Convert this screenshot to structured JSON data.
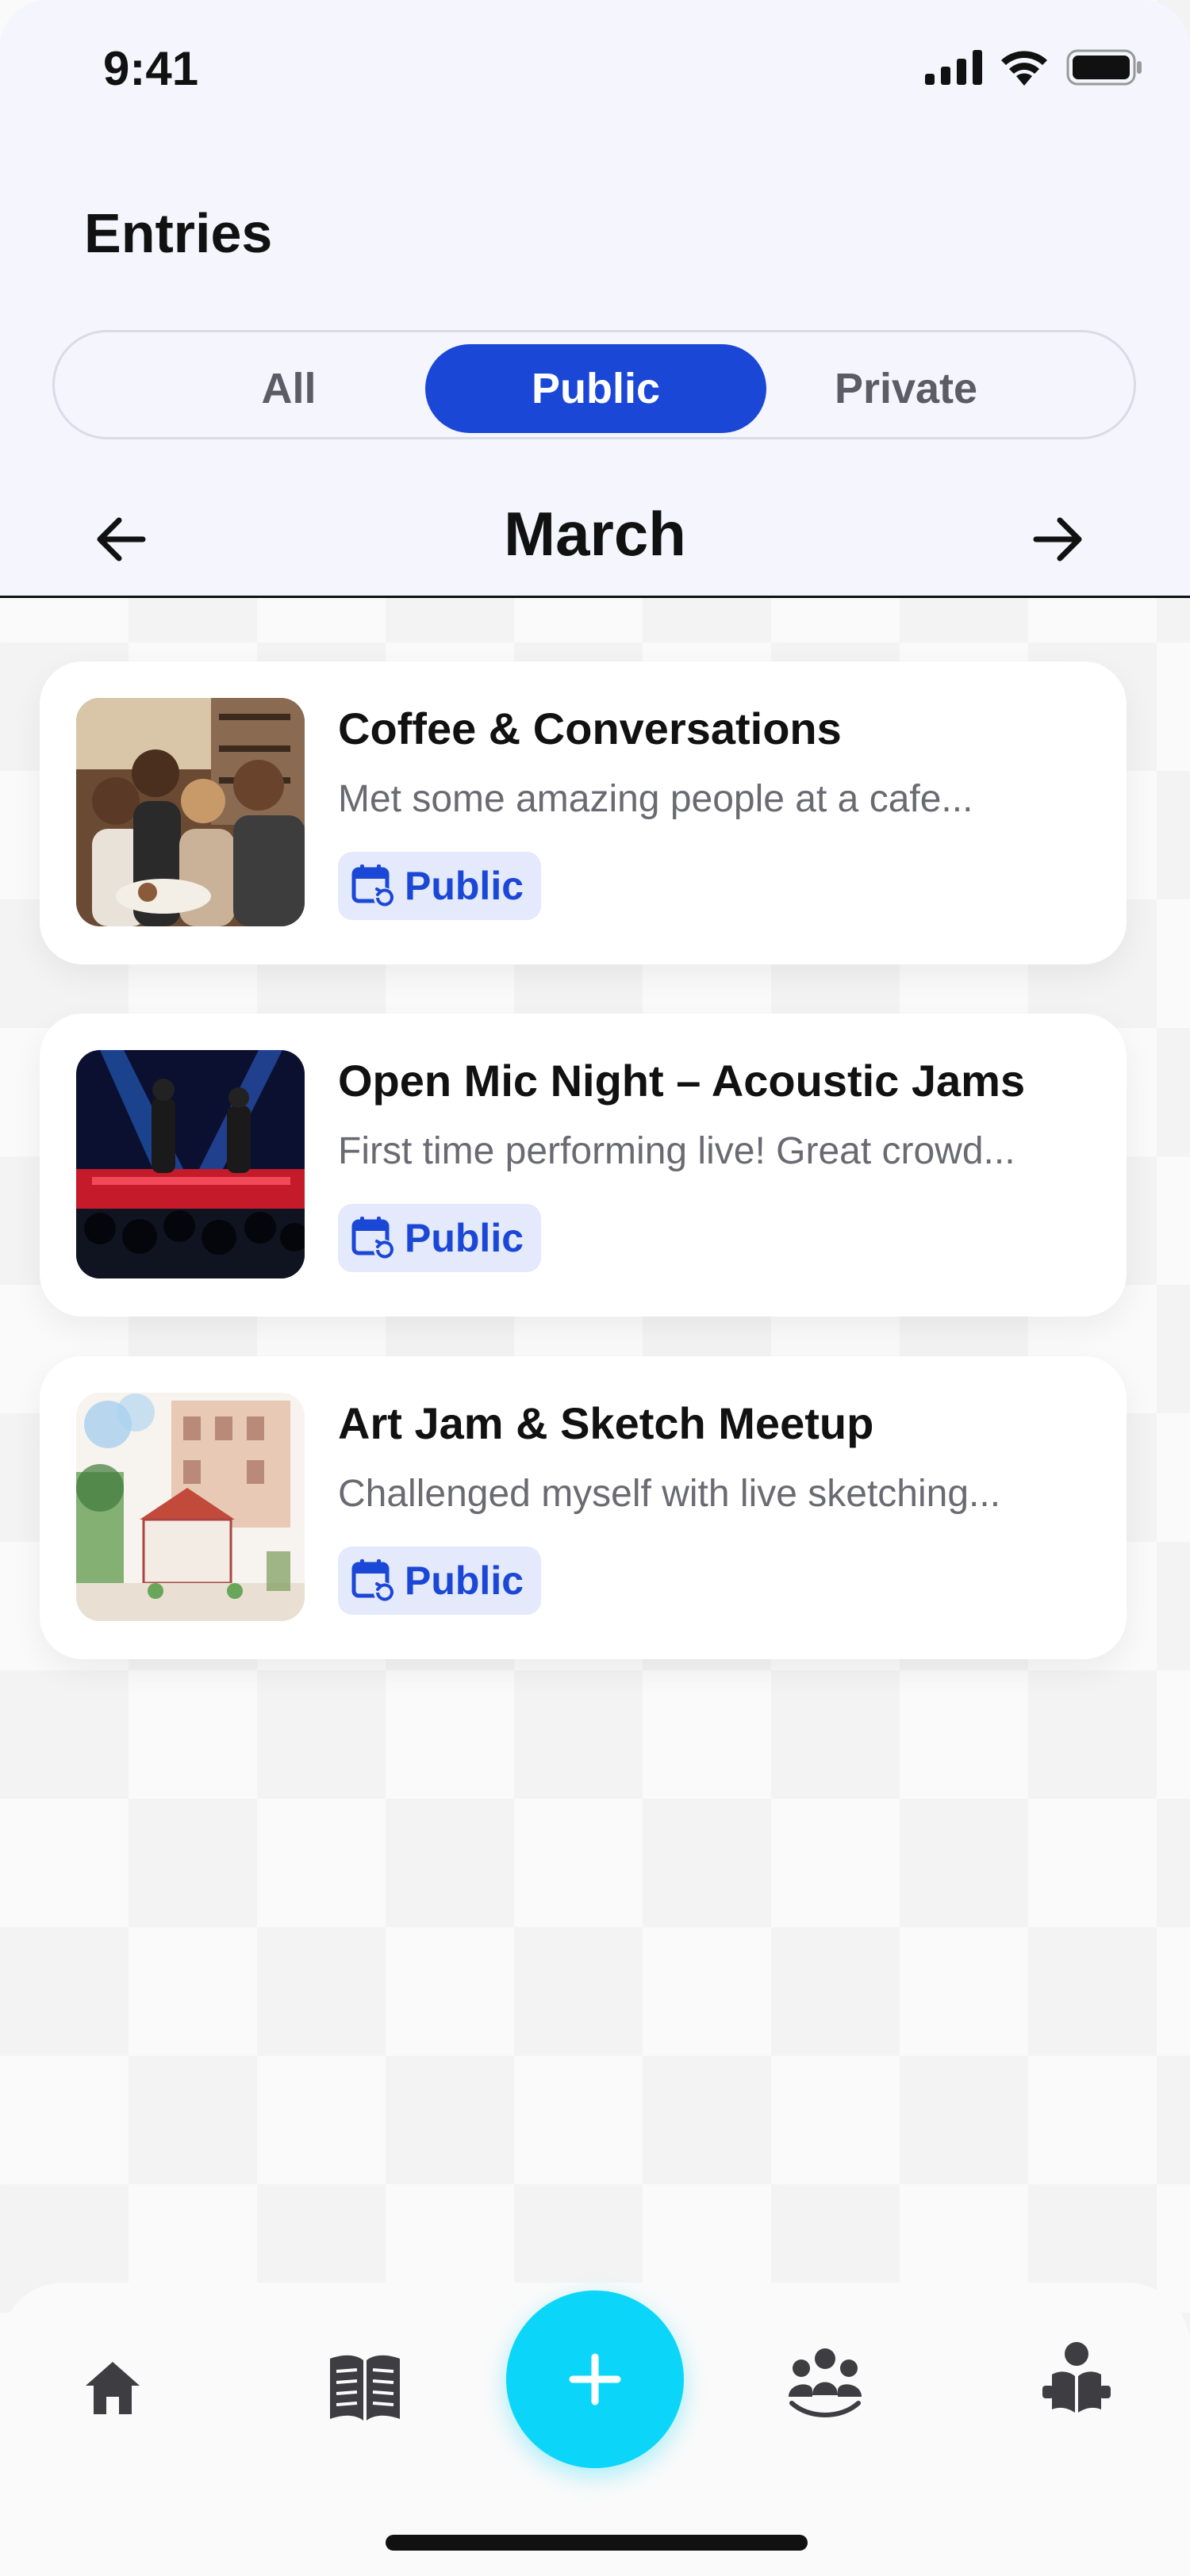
{
  "status_bar": {
    "time": "9:41"
  },
  "header": {
    "title": "Entries"
  },
  "filter_tabs": [
    {
      "label": "All",
      "active": false
    },
    {
      "label": "Public",
      "active": true
    },
    {
      "label": "Private",
      "active": false
    }
  ],
  "month_nav": {
    "month": "March",
    "prev_icon": "arrow-left-icon",
    "next_icon": "arrow-right-icon"
  },
  "entries": [
    {
      "title": "Coffee & Conversations",
      "description": "Met some amazing people at a cafe...",
      "badge": "Public",
      "badge_icon": "calendar-repeat-icon"
    },
    {
      "title": "Open Mic Night – Acoustic Jams",
      "description": "First time performing live! Great crowd...",
      "badge": "Public",
      "badge_icon": "calendar-repeat-icon"
    },
    {
      "title": "Art Jam & Sketch Meetup",
      "description": "Challenged myself with live sketching...",
      "badge": "Public",
      "badge_icon": "calendar-repeat-icon"
    }
  ],
  "bottom_nav": {
    "items": [
      "home-icon",
      "journal-icon",
      "add-icon",
      "community-icon",
      "reader-icon"
    ]
  },
  "colors": {
    "accent": "#1b47d6",
    "fab": "#0bd6f9",
    "header_bg": "#f4f5fd",
    "badge_bg": "#e4e9fb"
  }
}
